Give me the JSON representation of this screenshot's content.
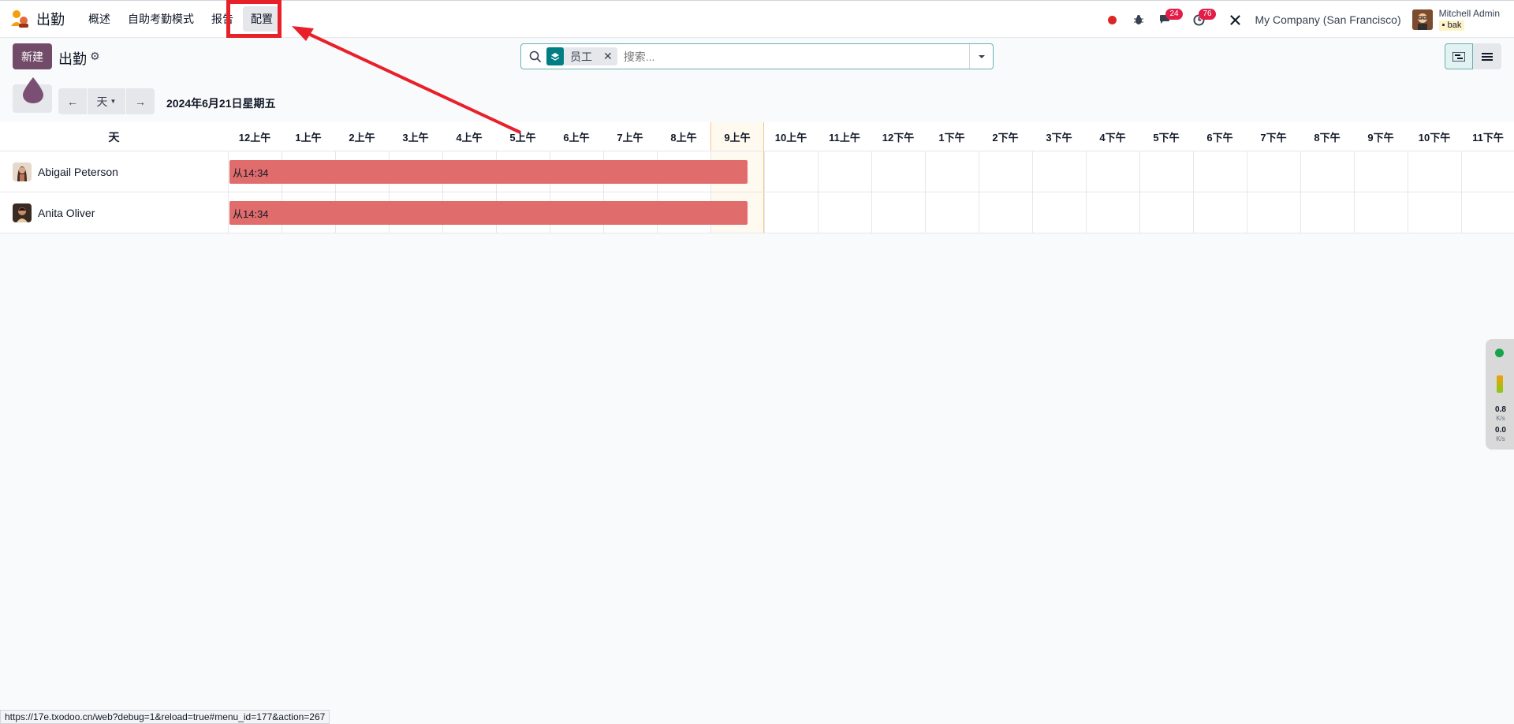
{
  "navbar": {
    "app_title": "出勤",
    "menu": [
      "概述",
      "自助考勤模式",
      "报告",
      "配置"
    ],
    "messages_count": "24",
    "activities_count": "76",
    "company": "My Company (San Francisco)",
    "user_name": "Mitchell Admin",
    "user_db": "bak"
  },
  "control": {
    "new_label": "新建",
    "breadcrumb": "出勤",
    "facet_label": "员工",
    "search_placeholder": "搜索..."
  },
  "gantt": {
    "scale_label": "天",
    "date": "2024年6月21日星期五",
    "row_header": "天",
    "hours": [
      "12上午",
      "1上午",
      "2上午",
      "3上午",
      "4上午",
      "5上午",
      "6上午",
      "7上午",
      "8上午",
      "9上午",
      "10上午",
      "11上午",
      "12下午",
      "1下午",
      "2下午",
      "3下午",
      "4下午",
      "5下午",
      "6下午",
      "7下午",
      "8下午",
      "9下午",
      "10下午",
      "11下午"
    ],
    "rows": [
      {
        "name": "Abigail Peterson",
        "pill_label": "从14:34"
      },
      {
        "name": "Anita Oliver",
        "pill_label": "从14:34"
      }
    ]
  },
  "side_widget": {
    "up": "0.8",
    "up_unit": "K/s",
    "down": "0.0",
    "down_unit": "K/s"
  },
  "status_url": "https://17e.txodoo.cn/web?debug=1&reload=true#menu_id=177&action=267",
  "colors": {
    "brand": "#714b67",
    "pill": "#e06c6c",
    "annotation": "#e8202a"
  }
}
